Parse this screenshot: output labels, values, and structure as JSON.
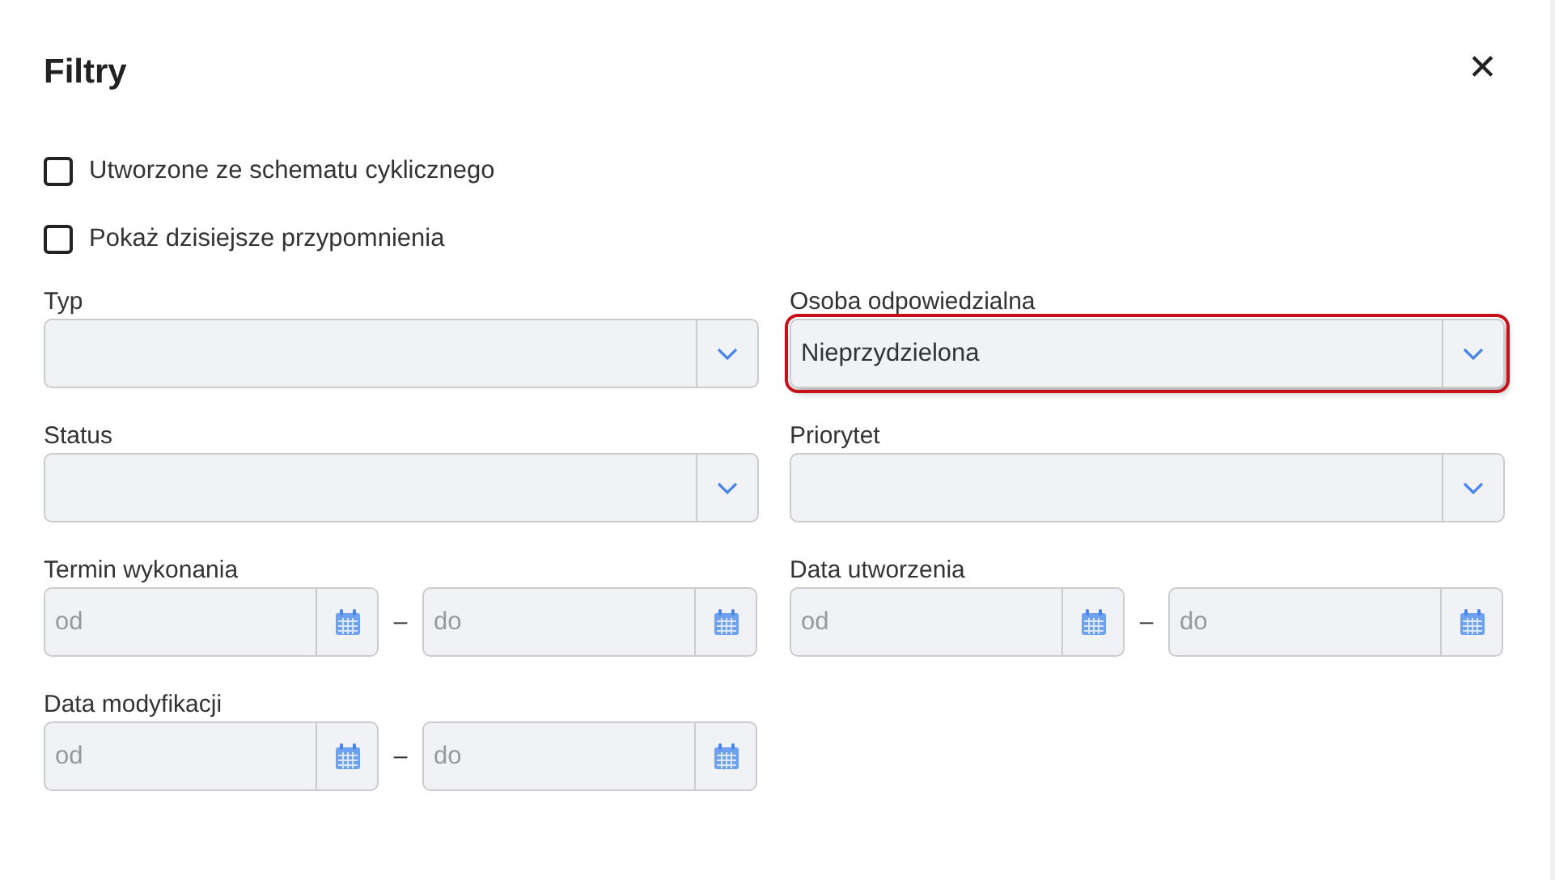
{
  "dialog": {
    "title": "Filtry",
    "close": "✕"
  },
  "checkboxes": [
    {
      "label": "Utworzone ze schematu cyklicznego",
      "checked": false
    },
    {
      "label": "Pokaż dzisiejsze przypomnienia",
      "checked": false
    }
  ],
  "fields": [
    {
      "kind": "select",
      "label": "Typ",
      "highlighted": false
    },
    {
      "kind": "select",
      "label": "Osoba odpowiedzialna",
      "value": "Nieprzydzielona",
      "highlighted": true
    },
    {
      "kind": "select",
      "label": "Status",
      "highlighted": false
    },
    {
      "kind": "select",
      "label": "Priorytet",
      "highlighted": false
    },
    {
      "kind": "date_range",
      "label": "Termin wykonania",
      "from_placeholder": "od",
      "separator": "–",
      "to_placeholder": "do"
    },
    {
      "kind": "date_range",
      "label": "Data utworzenia",
      "from_placeholder": "od",
      "separator": "–",
      "to_placeholder": "do"
    },
    {
      "kind": "date_range",
      "label": "Data modyfikacji",
      "from_placeholder": "od",
      "separator": "–",
      "to_placeholder": "do"
    }
  ]
}
